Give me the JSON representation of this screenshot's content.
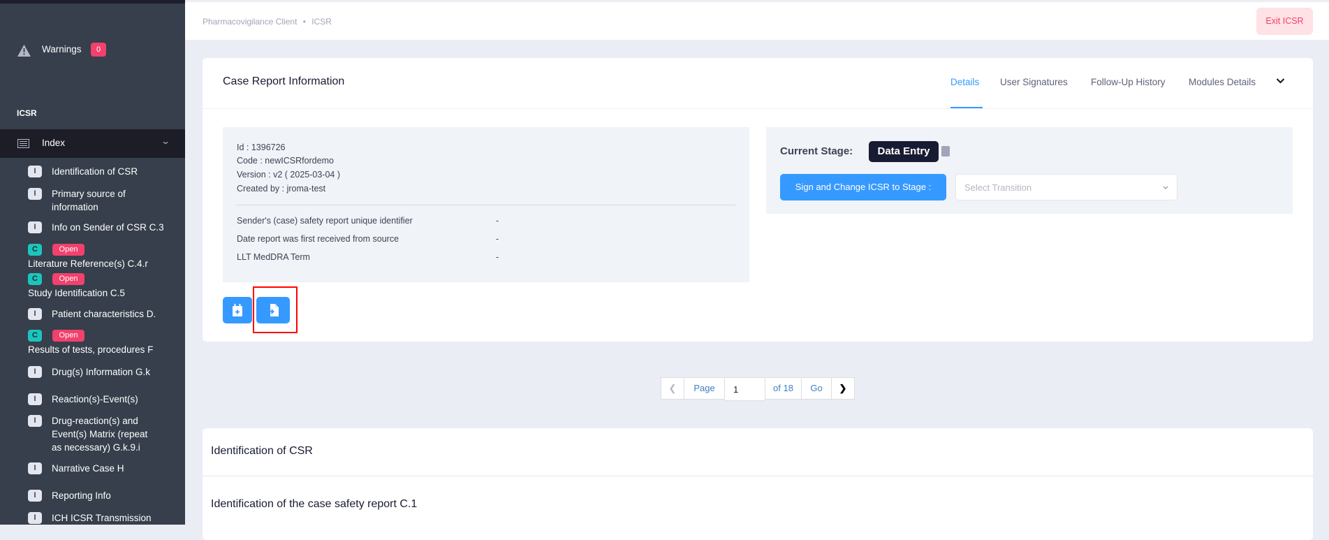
{
  "sidebar": {
    "warnings_label": "Warnings",
    "warnings_count": "0",
    "section_label": "ICSR",
    "index_label": "Index",
    "items": [
      {
        "badge": "I",
        "label": "Identification of CSR"
      },
      {
        "badge": "I",
        "label": "Primary source of",
        "label2": "information"
      },
      {
        "badge": "I",
        "label": "Info on Sender of CSR C.3"
      },
      {
        "badge": "C",
        "status": "Open",
        "label": "Literature Reference(s) C.4.r"
      },
      {
        "badge": "C",
        "status": "Open",
        "label": "Study Identification C.5"
      },
      {
        "badge": "I",
        "label": "Patient characteristics D."
      },
      {
        "badge": "C",
        "status": "Open",
        "label": "Results of tests, procedures F"
      },
      {
        "badge": "I",
        "label": "Drug(s) Information G.k"
      },
      {
        "badge": "I",
        "label": "Reaction(s)-Event(s)"
      },
      {
        "badge": "I",
        "label": "Drug-reaction(s) and",
        "label2": "Event(s) Matrix (repeat",
        "label3": "as necessary) G.k.9.i"
      },
      {
        "badge": "I",
        "label": "Narrative Case H"
      },
      {
        "badge": "I",
        "label": "Reporting Info"
      },
      {
        "badge": "I",
        "label": "ICH ICSR Transmission"
      }
    ]
  },
  "header": {
    "breadcrumb": [
      "Pharmacovigilance Client",
      "ICSR"
    ],
    "exit_label": "Exit ICSR"
  },
  "case_card": {
    "title": "Case Report Information",
    "tabs": [
      "Details",
      "User Signatures",
      "Follow-Up History",
      "Modules Details"
    ],
    "info_lines": [
      "Id : 1396726",
      "Code : newICSRfordemo",
      "Version : v2 ( 2025-03-04 )",
      "Created by : jroma-test"
    ],
    "fields": [
      {
        "label": "Sender's (case) safety report unique identifier",
        "value": "-"
      },
      {
        "label": "Date report was first received from source",
        "value": "-"
      },
      {
        "label": "LLT MedDRA Term",
        "value": "-"
      }
    ],
    "stage_label": "Current Stage:",
    "stage_value": "Data Entry",
    "sign_button": "Sign and Change ICSR to Stage :",
    "transition_placeholder": "Select Transition"
  },
  "pagination": {
    "page_label": "Page",
    "page_value": "1",
    "of_label": "of 18",
    "go_label": "Go"
  },
  "section": {
    "title": "Identification of CSR",
    "subtitle": "Identification of the case safety report C.1"
  }
}
